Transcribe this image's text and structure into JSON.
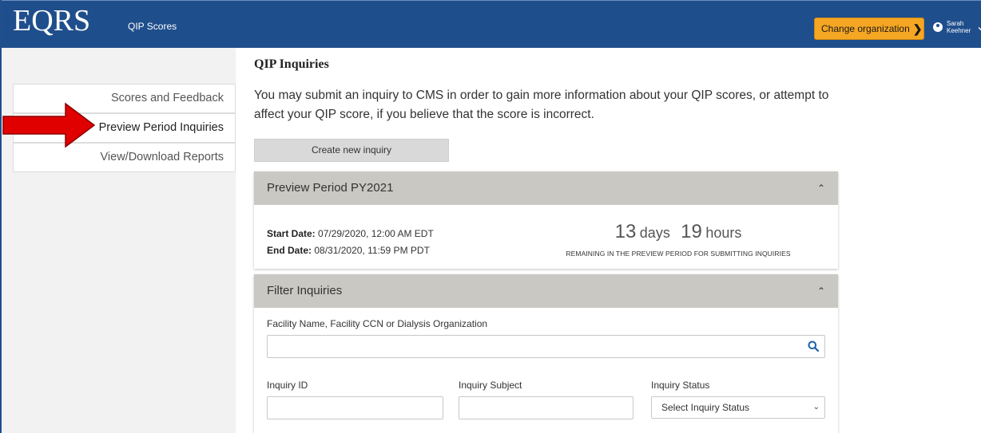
{
  "header": {
    "logo": "EQRS",
    "nav_link": "QIP Scores",
    "change_org_label": "Change organization",
    "user_first": "Sarah",
    "user_last": "Keehner"
  },
  "sidebar": {
    "items": [
      {
        "label": "Scores and Feedback"
      },
      {
        "label": "Preview Period Inquiries"
      },
      {
        "label": "View/Download Reports"
      }
    ]
  },
  "main": {
    "title": "QIP Inquiries",
    "intro": "You may submit an inquiry to CMS in order to gain more information about your QIP scores, or attempt to affect your QIP score, if you believe that the score is incorrect.",
    "create_button": "Create new inquiry",
    "preview_panel": {
      "title": "Preview Period PY2021",
      "start_label": "Start Date:",
      "start_value": "07/29/2020, 12:00 AM EDT",
      "end_label": "End Date:",
      "end_value": "08/31/2020, 11:59 PM PDT",
      "days_num": "13",
      "days_unit": "days",
      "hours_num": "19",
      "hours_unit": "hours",
      "remaining_text": "REMAINING IN THE PREVIEW PERIOD FOR SUBMITTING INQUIRIES"
    },
    "filter_panel": {
      "title": "Filter Inquiries",
      "facility_label": "Facility Name, Facility CCN or Dialysis Organization",
      "facility_value": "",
      "inquiry_id_label": "Inquiry ID",
      "inquiry_subject_label": "Inquiry Subject",
      "inquiry_status_label": "Inquiry Status",
      "status_selected": "Select Inquiry Status"
    }
  },
  "colors": {
    "topbar": "#1f4e8c",
    "org_button": "#f5a623",
    "panel_header": "#c9c8c3",
    "annotation_arrow": "#e00000"
  }
}
